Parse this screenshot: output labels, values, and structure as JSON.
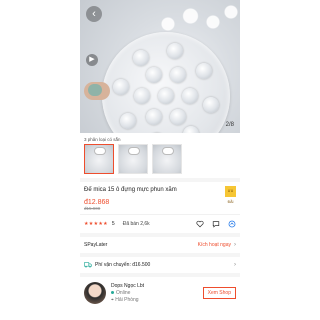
{
  "hero": {
    "back_icon": "chevron-left-icon",
    "play_icon": "play-icon",
    "image_counter": "2/8"
  },
  "variants": {
    "label": "3 phân loại có sẵn",
    "count": 3
  },
  "product": {
    "title": "Đế mica 15 ô đựng mực phun xăm",
    "badge": "ƯU ĐÃI",
    "price": "đ12.868",
    "original_price": "đ15.900"
  },
  "rating": {
    "stars": "★★★★★",
    "value": "5",
    "sold": "Đã bán 2,6k",
    "icons": [
      "heart-icon",
      "message-icon",
      "share-icon"
    ]
  },
  "spaylater": {
    "label": "SPayLater",
    "action": "Kích hoạt ngay",
    "chevron": "›"
  },
  "shipping": {
    "label": "Phí vận chuyển: đ16.500",
    "chevron": "›"
  },
  "shop": {
    "name": "Dops Ngọc Lbt",
    "status": "Online",
    "location": "Hải Phòng",
    "view_button": "Xem Shop"
  },
  "colors": {
    "accent": "#ee4d2d",
    "badge": "#f6c634",
    "online": "#26aa99"
  }
}
